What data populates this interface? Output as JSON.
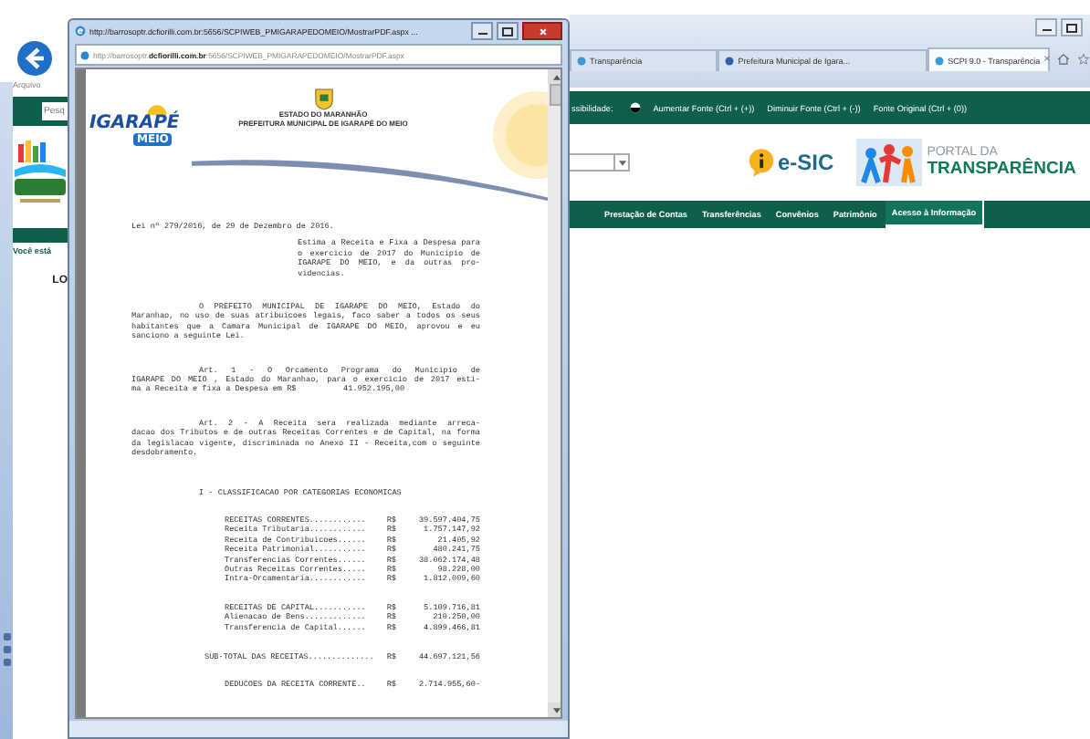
{
  "browser": {
    "menu_item": "Arquivo",
    "tabs": [
      {
        "label": "Transparência",
        "selected": false
      },
      {
        "label": "Prefeitura Municipal de Igara...",
        "selected": false
      },
      {
        "label": "SCPI 9.0 - Transparência",
        "selected": true,
        "close": "×"
      }
    ]
  },
  "site": {
    "search": {
      "placeholder": "Pesq"
    },
    "accessibility": {
      "label": "ssibilidade:",
      "links": [
        "Aumentar Fonte (Ctrl + (+))",
        "Diminuir Fonte (Ctrl + (-))",
        "Fonte Original (Ctrl + (0))"
      ]
    },
    "esic_logo": "e-SIC",
    "portal_logo": [
      "PORTAL DA",
      "TRANSPARÊNCIA"
    ],
    "nav": [
      {
        "label": "Prestação de Contas",
        "selected": false
      },
      {
        "label": "Transferências",
        "selected": false
      },
      {
        "label": "Convênios",
        "selected": false
      },
      {
        "label": "Patrimônio",
        "selected": false
      },
      {
        "label": "Acesso à Informação",
        "selected": true
      }
    ],
    "breadcrumb": "Você está",
    "heading": "LO"
  },
  "popup": {
    "title": "http://barrosoptr.dcfiorilli.com.br:5656/SCPIWEB_PMIGARAPEDOMEIO/MostrarPDF.aspx ...",
    "address": "http://barrosoptr.**dcfiorilli.com.br**:5656/SCPIWEB_PMIGARAPEDOMEIO/MostrarPDF.aspx",
    "document": {
      "logo": [
        "IGARAPÉ",
        "MEIO"
      ],
      "seal_lines": [
        "ESTADO DO MARANHÃO",
        "PREFEITURA MUNICIPAL DE IGARAPÉ DO MEIO"
      ],
      "law_title": "Lei nº 279/2016, de 29 de Dezembro de 2016.",
      "summary": [
        "Estima a Receita e Fixa a Despesa para",
        "o exercicio de 2017 do Municipio de",
        "IGARAPE DO MEIO, e da outras pro-",
        "videncias."
      ],
      "paragraphs": [
        {
          "lines": [
            "O PREFEITO MUNICIPAL DE IGARAPE DO MEIO, Estado do",
            "Maranhao, no uso de suas atribuicoes legais, faco saber a todos os seus",
            "habitantes que a Camara Municipal de IGARAPE DO MEIO, aprovou e eu",
            "sanciono a seguinte Lei."
          ]
        },
        {
          "lines": [
            "Art. 1 - O Orcamento Programa do Municipio de",
            "IGARAPE DO MEIO , Estado do Maranhao, para o exercicio de 2017 esti-",
            "ma a Receita e fixa a Despesa em R$          41.952.195,00"
          ]
        },
        {
          "lines": [
            "Art. 2 - A Receita sera realizada mediante arreca-",
            "dacao dos Tributos e de outras Receitas Correntes e de Capital, na forma",
            "da legislacao vigente, discriminada no Anexo II - Receita,com o seguinte",
            "desdobramento."
          ]
        }
      ],
      "section": "I - CLASSIFICACAO POR CATEGORIAS ECONOMICAS",
      "groups": [
        {
          "kind": "detail",
          "rows": [
            {
              "label": "RECEITAS CORRENTES............",
              "currency": "R$",
              "amount": "39.597.404,75"
            },
            {
              "label": "Receita Tributaria............",
              "currency": "R$",
              "amount": "1.757.147,92"
            },
            {
              "label": "Receita de Contribuicoes......",
              "currency": "R$",
              "amount": "21.405,92"
            },
            {
              "label": "Receita Patrimonial...........",
              "currency": "R$",
              "amount": "480.241,75"
            },
            {
              "label": "Transferencias Correntes......",
              "currency": "R$",
              "amount": "38.062.174,48"
            },
            {
              "label": "Outras Receitas Correntes.....",
              "currency": "R$",
              "amount": "98.228,00"
            },
            {
              "label": "Intra-Orcamentaria............",
              "currency": "R$",
              "amount": "1.812.009,60"
            }
          ]
        },
        {
          "kind": "detail",
          "rows": [
            {
              "label": "RECEITAS DE CAPITAL...........",
              "currency": "R$",
              "amount": "5.109.716,81"
            },
            {
              "label": "Alienacao de Bens.............",
              "currency": "R$",
              "amount": "210.250,00"
            },
            {
              "label": "Transferencia de Capital......",
              "currency": "R$",
              "amount": "4.899.466,81"
            }
          ]
        },
        {
          "kind": "total",
          "rows": [
            {
              "label": "SUB-TOTAL DAS RECEITAS..............",
              "currency": "R$",
              "amount": "44.697.121,56"
            }
          ]
        },
        {
          "kind": "detail",
          "rows": [
            {
              "label": "DEDUCOES DA RECEITA CORRENTE..",
              "currency": "R$",
              "amount": "2.714.955,60-"
            }
          ]
        }
      ]
    }
  }
}
